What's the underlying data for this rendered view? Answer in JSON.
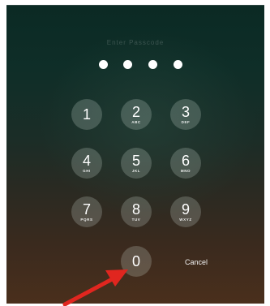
{
  "lock_screen": {
    "hint": "Enter Passcode",
    "dots_count": 4,
    "keys": [
      {
        "digit": "1",
        "letters": ""
      },
      {
        "digit": "2",
        "letters": "ABC"
      },
      {
        "digit": "3",
        "letters": "DEF"
      },
      {
        "digit": "4",
        "letters": "GHI"
      },
      {
        "digit": "5",
        "letters": "JKL"
      },
      {
        "digit": "6",
        "letters": "MNO"
      },
      {
        "digit": "7",
        "letters": "PQRS"
      },
      {
        "digit": "8",
        "letters": "TUV"
      },
      {
        "digit": "9",
        "letters": "WXYZ"
      },
      {
        "digit": "0",
        "letters": ""
      }
    ],
    "cancel_label": "Cancel"
  },
  "colors": {
    "arrow": "#e0261f",
    "key_fill": "rgba(220,230,225,0.22)",
    "dot": "#ffffff"
  },
  "icons": {
    "annotation": "red-arrow-icon"
  }
}
